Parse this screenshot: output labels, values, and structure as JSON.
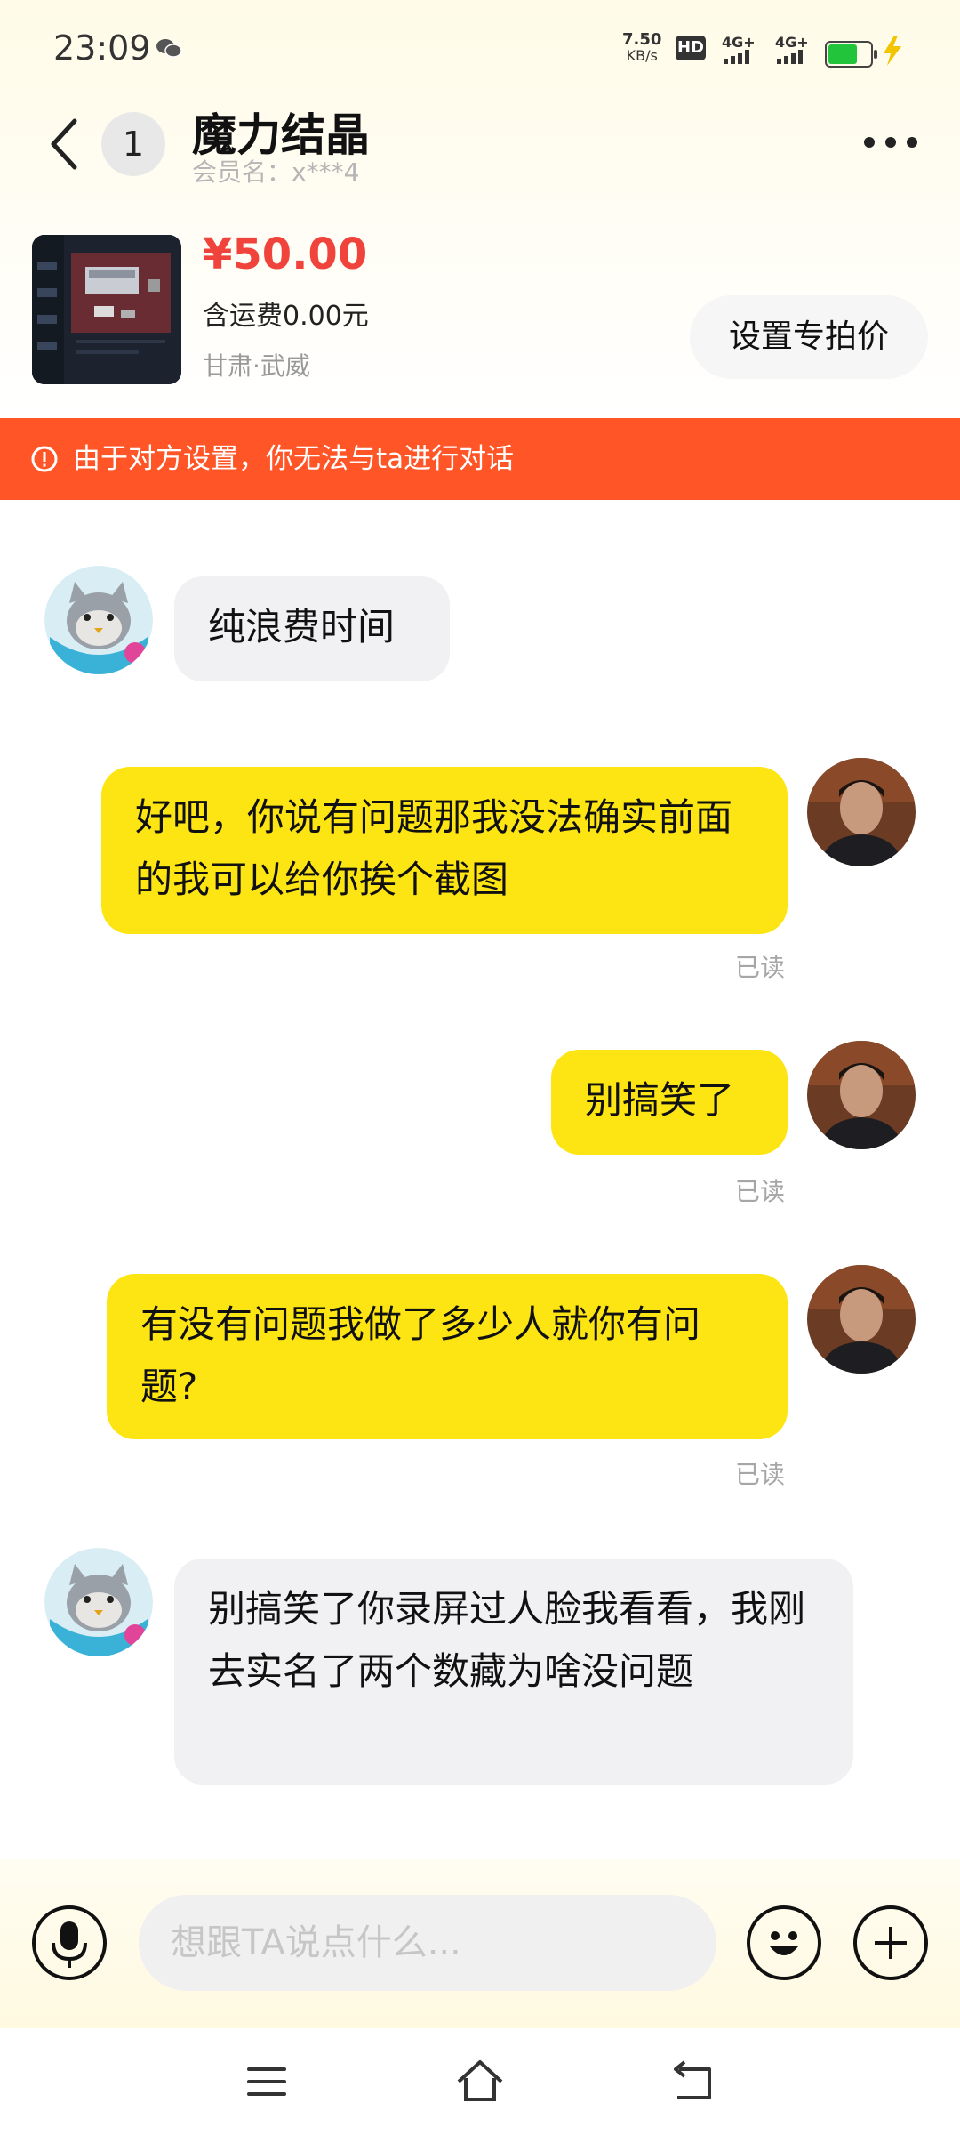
{
  "status_bar": {
    "time": "23:09",
    "net_speed_value": "7.50",
    "net_speed_unit": "KB/s",
    "hd_label": "HD",
    "sim1_label": "4G+",
    "sim2_label": "4G+",
    "battery_color": "#21c43a"
  },
  "header": {
    "back_icon": "chevron-left-icon",
    "unread_count": "1",
    "title": "魔力结晶",
    "member_name": "会员名：x***4",
    "more_icon": "more-horizontal-icon"
  },
  "product": {
    "price": "¥50.00",
    "shipping": "含运费0.00元",
    "location": "甘肃·武威",
    "set_price_button": "设置专拍价"
  },
  "banner": {
    "text": "由于对方设置，你无法与ta进行对话",
    "color": "#ff5527",
    "icon": "alert-circle-icon"
  },
  "messages": [
    {
      "side": "left",
      "text": "纯浪费时间"
    },
    {
      "side": "right",
      "text": "好吧，你说有问题那我没法确实前面的我可以给你挨个截图",
      "status": "已读"
    },
    {
      "side": "right",
      "text": "别搞笑了",
      "status": "已读"
    },
    {
      "side": "right",
      "text": "有没有问题我做了多少人就你有问题?",
      "status": "已读"
    },
    {
      "side": "left",
      "text": "别搞笑了你录屏过人脸我看看，我刚去实名了两个数藏为啥没问题"
    }
  ],
  "input": {
    "placeholder": "想跟TA说点什么...",
    "voice_icon": "microphone-icon",
    "emoji_icon": "emoji-icon",
    "plus_icon": "plus-icon"
  },
  "nav": {
    "menu_icon": "menu-icon",
    "home_icon": "home-icon",
    "back_icon": "return-icon"
  },
  "colors": {
    "accent_yellow": "#fde514",
    "price_red": "#f0433c",
    "bubble_gray": "#f1f1f3"
  }
}
